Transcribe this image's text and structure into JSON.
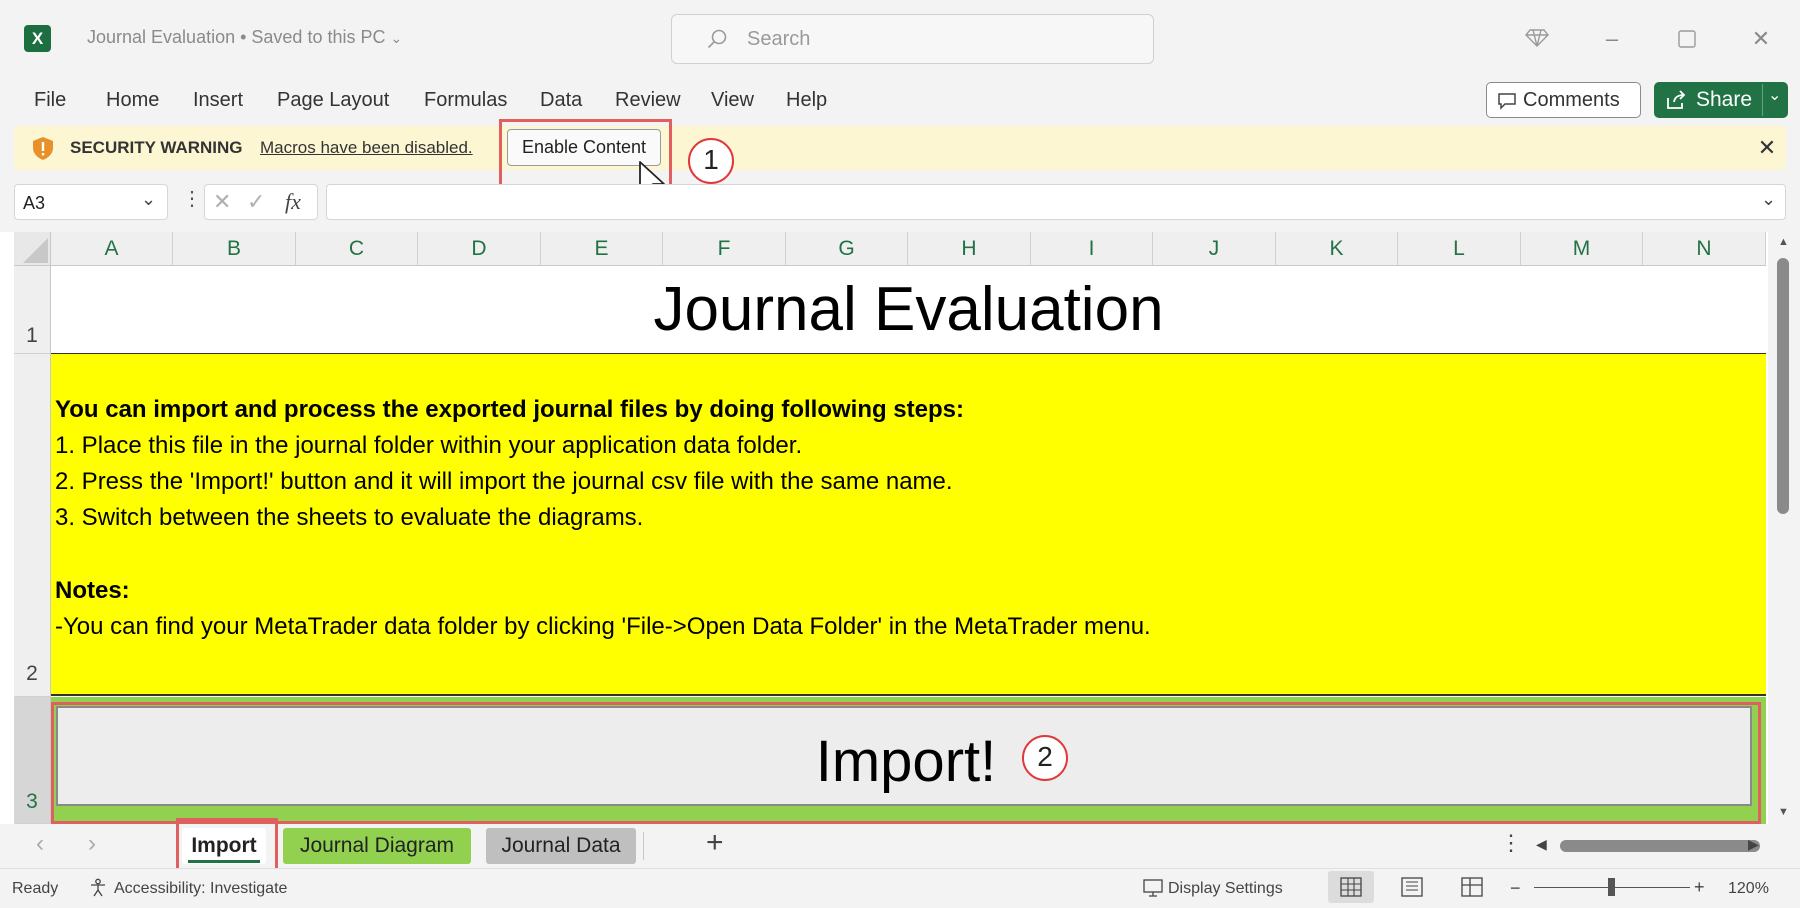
{
  "window": {
    "title": "Journal Evaluation • Saved to this PC",
    "app_icon": "X",
    "search_placeholder": "Search"
  },
  "menu": {
    "items": [
      "File",
      "Home",
      "Insert",
      "Page Layout",
      "Formulas",
      "Data",
      "Review",
      "View",
      "Help"
    ],
    "comments_label": "Comments",
    "share_label": "Share"
  },
  "security_bar": {
    "label": "SECURITY WARNING",
    "message": "Macros have been disabled.",
    "enable_button": "Enable Content",
    "callout_number": "1"
  },
  "formula_bar": {
    "name_box": "A3",
    "fx_label": "fx",
    "formula_value": ""
  },
  "grid": {
    "columns": [
      "A",
      "B",
      "C",
      "D",
      "E",
      "F",
      "G",
      "H",
      "I",
      "J",
      "K",
      "L",
      "M",
      "N"
    ],
    "rows": [
      "1",
      "2",
      "3"
    ],
    "title": "Journal Evaluation",
    "instructions_heading": "You can import and process the exported journal files by doing following steps:",
    "steps": [
      "1. Place this file in the journal folder within your application data folder.",
      "2. Press the 'Import!' button and it will import the journal csv file with the same name.",
      "3. Switch between the sheets to evaluate the diagrams."
    ],
    "notes_heading": "Notes:",
    "note": "-You can find your MetaTrader data folder by clicking 'File->Open Data Folder' in the MetaTrader menu.",
    "import_button": "Import!",
    "callout_number": "2"
  },
  "sheet_tabs": {
    "tabs": [
      {
        "label": "Import",
        "active": true,
        "color": "#ffff00"
      },
      {
        "label": "Journal Diagram",
        "active": false,
        "color": "#92d050"
      },
      {
        "label": "Journal Data",
        "active": false,
        "color": "#bfbfbf"
      }
    ],
    "add_label": "+"
  },
  "status_bar": {
    "status": "Ready",
    "accessibility": "Accessibility: Investigate",
    "display_settings": "Display Settings",
    "zoom": "120%",
    "zoom_minus": "−",
    "zoom_plus": "+"
  },
  "colors": {
    "excel_green": "#217346",
    "callout_red": "#e03838"
  }
}
